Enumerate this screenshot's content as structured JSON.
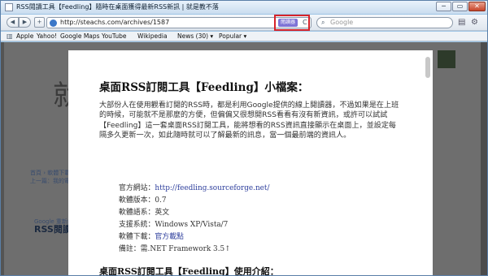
{
  "window": {
    "title": "RSS閱讀工具【Feedling】隨時在桌面獲得最新RSS新訊 | 就是教不落",
    "minimize_label": "─",
    "maximize_label": "▭",
    "close_label": "✕"
  },
  "navbar": {
    "back_label": "◀",
    "forward_label": "▶",
    "add_label": "+",
    "url": "http://steachs.com/archives/1587",
    "rss_badge": "閱讀器",
    "reload_label": "C",
    "search_placeholder": "Google"
  },
  "bookmarks": {
    "items": [
      {
        "label": "Apple"
      },
      {
        "label": "Yahoo!"
      },
      {
        "label": "Google Maps"
      },
      {
        "label": "YouTube"
      },
      {
        "label": "Wikipedia"
      },
      {
        "label": "News (30) ▾"
      },
      {
        "label": "Popular ▾"
      }
    ]
  },
  "background_page": {
    "logo": "就",
    "breadcrumb": "首頁 › 軟體下載",
    "prev_link": "上一篇：我的電腦",
    "post_title": "RSS閱讀工",
    "meta": "Google 重新的"
  },
  "article": {
    "title": "桌面RSS訂閱工具【Feedling】小檔案：",
    "paragraph": "大部份人在使用觀看訂閱的RSS時，都是利用Google提供的線上閱讀器，不過如果是在上班的時候，可能就不是那麼的方便，但偏偏又很想開RSS看看有沒有新資訊，或許可以試試【Feedling】這一套桌面RSS訂閱工具，能將想看的RSS資訊直接顯示在桌面上，並設定每隔多久更新一次，如此隨時就可以了解最新的訊息，當一個最前端的資訊人。",
    "info": [
      {
        "key": "官方網站：",
        "value": "http://feedling.sourceforge.net/",
        "is_link": true
      },
      {
        "key": "軟體版本：",
        "value": "0.7",
        "is_link": false
      },
      {
        "key": "軟體語系：",
        "value": "英文",
        "is_link": false
      },
      {
        "key": "支援系統：",
        "value": "Windows XP/Vista/7",
        "is_link": false
      },
      {
        "key": "軟體下載：",
        "value": "官方載點",
        "is_link": true
      },
      {
        "key": "備註：",
        "value": "需.NET Framework 3.5↑",
        "is_link": false
      }
    ],
    "subtitle": "桌面RSS訂閱工具【Feedling】使用介紹："
  }
}
